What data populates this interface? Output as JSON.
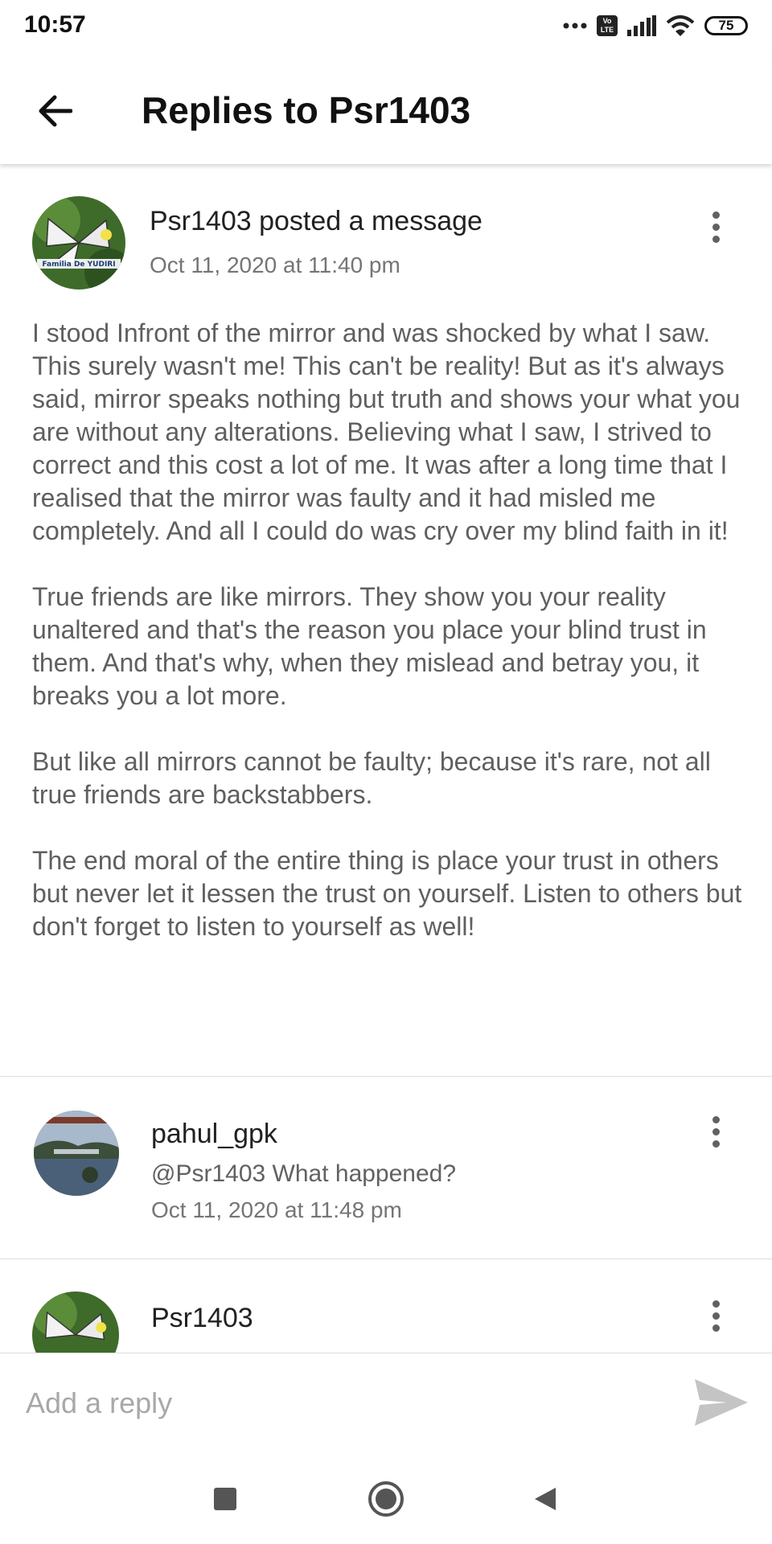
{
  "status_bar": {
    "time": "10:57",
    "battery": "75",
    "icons": [
      "more-dots-icon",
      "volte-icon",
      "signal-icon",
      "wifi-icon",
      "battery-icon"
    ]
  },
  "app_bar": {
    "title": "Replies to Psr1403",
    "back_icon": "arrow-left-icon"
  },
  "post": {
    "author": "Psr1403",
    "action": " posted a message",
    "date": "Oct 11, 2020 at 11:40 pm",
    "avatar_caption": "Familia De YUDIRI",
    "paragraphs": [
      "I stood Infront of the mirror and was shocked by what I saw. This surely wasn't me! This can't be reality! But as it's always said, mirror speaks nothing but truth and shows your what you are without any alterations. Believing what I saw, I strived to correct and this cost a lot of me. It was after a long time that I realised that the mirror was faulty and it had misled me completely. And all I could do was cry over my blind faith in it!",
      "True friends are like mirrors. They show you your reality unaltered and that's the reason you place your blind trust in them. And that's why, when they mislead and betray you, it breaks you a lot more.",
      "But like all mirrors cannot be faulty; because it's rare, not all true friends are backstabbers.",
      "The end moral of the entire thing is place your trust in others but never let it lessen the trust on yourself. Listen to others but don't forget to listen to yourself as well!"
    ]
  },
  "replies": [
    {
      "author": "pahul_gpk",
      "text": "@Psr1403 What happened?",
      "date": "Oct 11, 2020 at 11:48 pm"
    },
    {
      "author": "Psr1403",
      "text": "",
      "date": ""
    }
  ],
  "reply_input": {
    "placeholder": "Add a reply",
    "send_icon": "send-icon"
  },
  "nav_bar": {
    "icons": [
      "recents-square-icon",
      "home-circle-icon",
      "back-triangle-icon"
    ]
  }
}
